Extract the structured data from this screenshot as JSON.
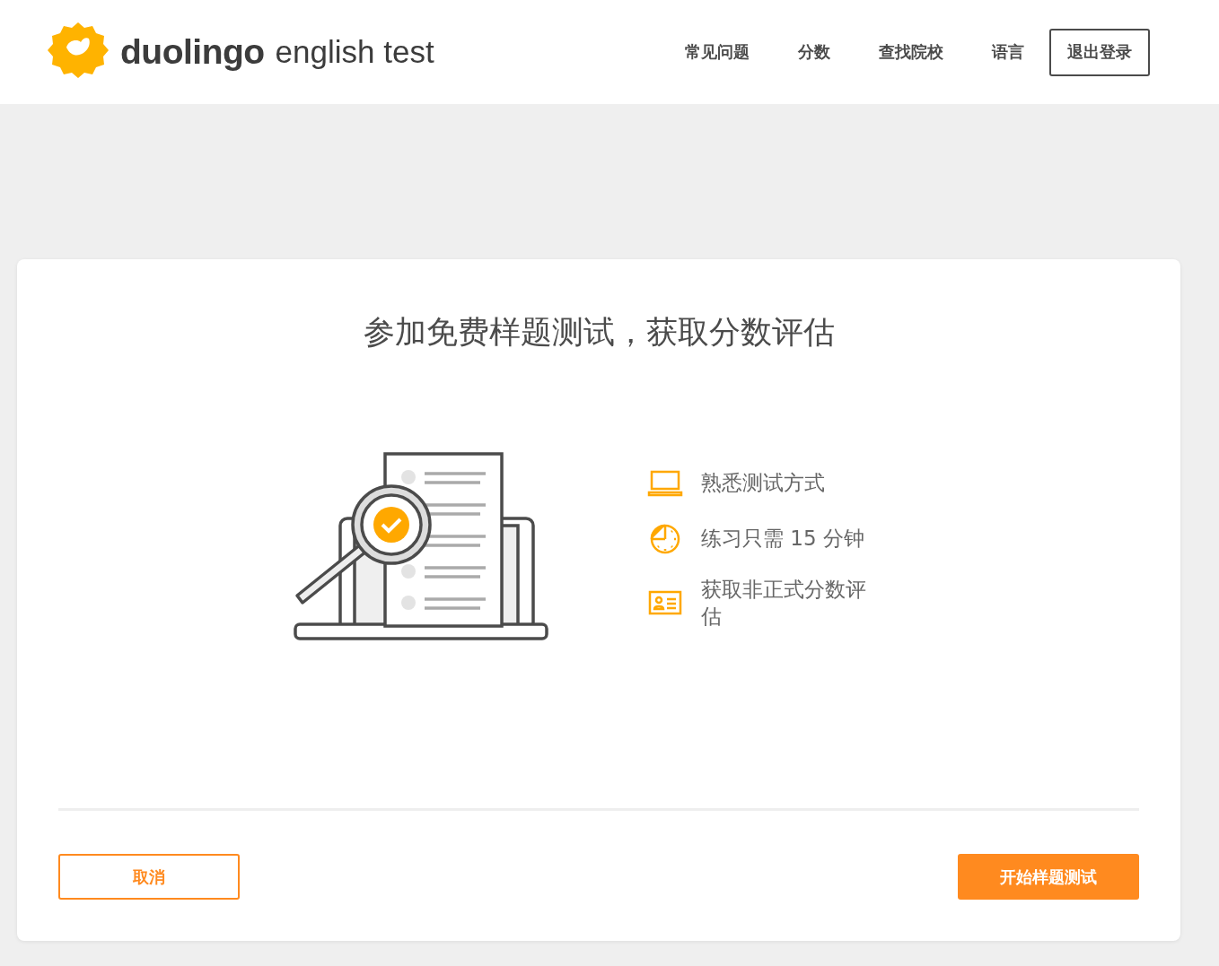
{
  "header": {
    "logo": {
      "brand": "duolingo",
      "product": "english test"
    },
    "nav": [
      {
        "label": "常见问题"
      },
      {
        "label": "分数"
      },
      {
        "label": "查找院校"
      },
      {
        "label": "语言"
      }
    ],
    "logout_button": "退出登录"
  },
  "card": {
    "title": "参加免费样题测试，获取分数评估",
    "features": [
      {
        "kind": "laptop",
        "text": "熟悉测试方式"
      },
      {
        "kind": "clock",
        "text": "练习只需 15 分钟"
      },
      {
        "kind": "card",
        "text": "获取非正式分数评估"
      }
    ],
    "cancel_button": "取消",
    "start_button": "开始样题测试"
  }
}
